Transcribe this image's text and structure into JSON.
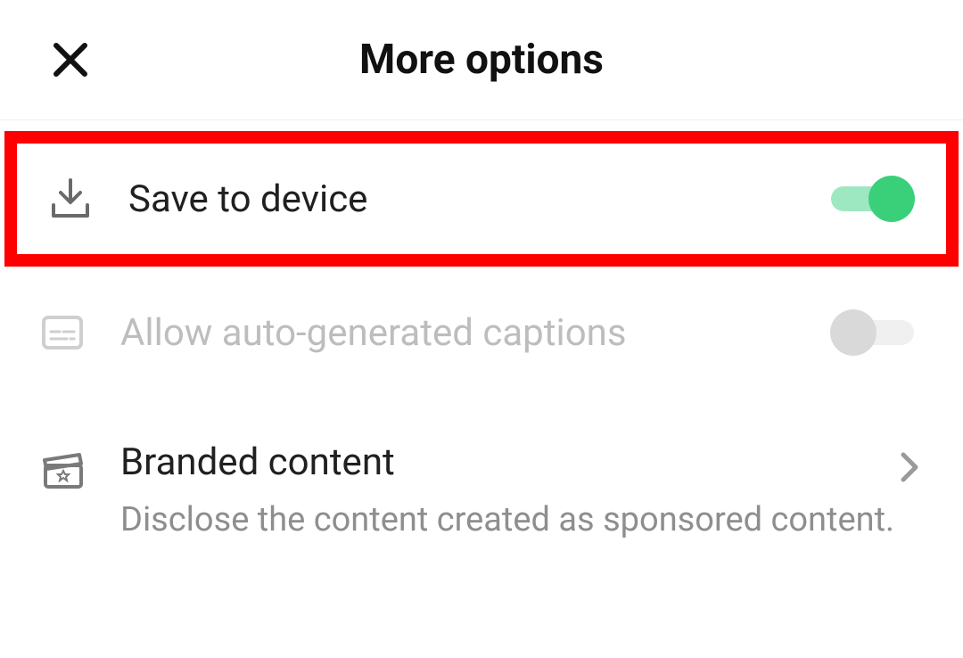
{
  "header": {
    "title": "More options"
  },
  "options": {
    "save_to_device": {
      "label": "Save to device",
      "enabled": true
    },
    "auto_captions": {
      "label": "Allow auto-generated captions",
      "enabled": false
    },
    "branded_content": {
      "label": "Branded content",
      "description": "Disclose the content created as sponsored content."
    }
  },
  "highlight_color": "#ff0000",
  "colors": {
    "toggle_on_track": "#9ee8c1",
    "toggle_on_knob": "#3ad07a",
    "toggle_off_track": "#f0f0f0",
    "toggle_off_knob": "#d9d9d9"
  }
}
